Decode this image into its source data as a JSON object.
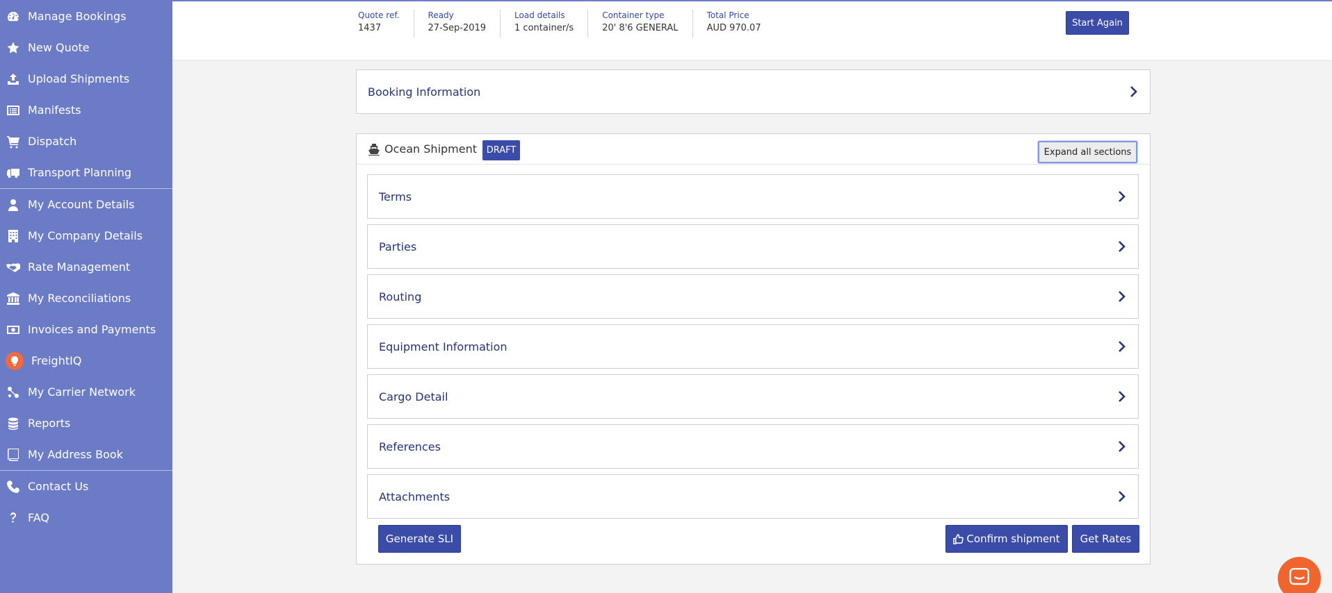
{
  "sidebar": {
    "groups": [
      [
        {
          "label": "Manage Bookings",
          "icon": "dashboard-icon"
        },
        {
          "label": "New Quote",
          "icon": "star-icon"
        },
        {
          "label": "Upload Shipments",
          "icon": "upload-icon"
        },
        {
          "label": "Manifests",
          "icon": "list-icon"
        },
        {
          "label": "Dispatch",
          "icon": "cart-icon"
        },
        {
          "label": "Transport Planning",
          "icon": "truck-icon"
        }
      ],
      [
        {
          "label": "My Account Details",
          "icon": "user-icon"
        },
        {
          "label": "My Company Details",
          "icon": "building-icon"
        },
        {
          "label": "Rate Management",
          "icon": "handshake-icon"
        },
        {
          "label": "My Reconciliations",
          "icon": "bank-icon"
        },
        {
          "label": "Invoices and Payments",
          "icon": "money-icon"
        },
        {
          "label": "FreightIQ",
          "icon": "lightbulb-icon"
        },
        {
          "label": "My Carrier Network",
          "icon": "network-icon"
        },
        {
          "label": "Reports",
          "icon": "database-icon"
        },
        {
          "label": "My Address Book",
          "icon": "book-icon"
        }
      ],
      [
        {
          "label": "Contact Us",
          "icon": "phone-icon"
        },
        {
          "label": "FAQ",
          "icon": "question-icon"
        }
      ]
    ]
  },
  "header": {
    "summary": [
      {
        "label": "Quote ref.",
        "value": "1437"
      },
      {
        "label": "Ready",
        "value": "27-Sep-2019"
      },
      {
        "label": "Load details",
        "value": "1 container/s"
      },
      {
        "label": "Container type",
        "value": "20' 8'6 GENERAL"
      },
      {
        "label": "Total Price",
        "value": "AUD 970.07"
      }
    ],
    "start_again": "Start Again"
  },
  "booking": {
    "title": "Booking Information"
  },
  "shipment": {
    "title": "Ocean Shipment",
    "badge": "DRAFT",
    "expand_all": "Expand all sections",
    "sections": [
      "Terms",
      "Parties",
      "Routing",
      "Equipment Information",
      "Cargo Detail",
      "References",
      "Attachments"
    ],
    "actions": {
      "generate_sli": "Generate SLI",
      "confirm": "Confirm shipment",
      "get_rates": "Get Rates"
    }
  },
  "colors": {
    "sidebar": "#6c7bc6",
    "primary_button": "#3a4ba8",
    "title_text": "#24337a",
    "chat": "#f0642e"
  }
}
